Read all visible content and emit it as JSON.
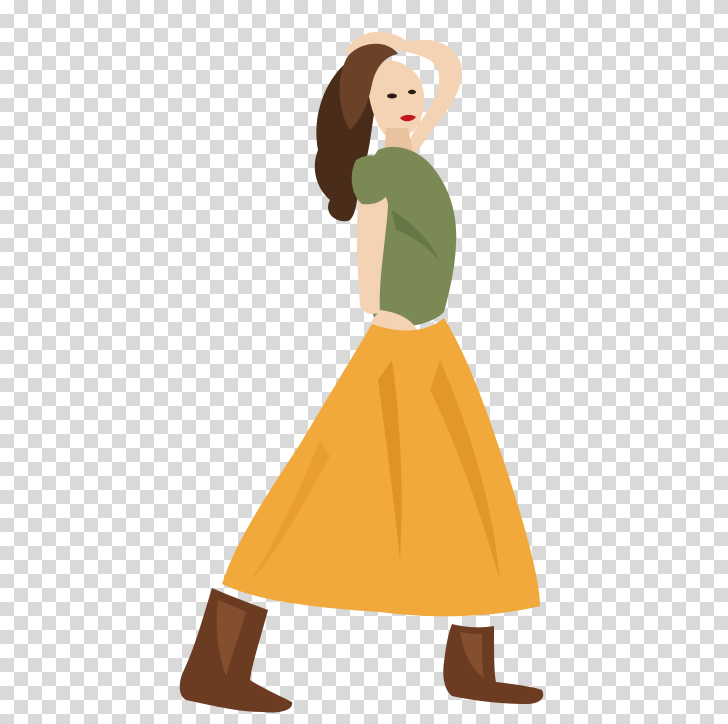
{
  "image": {
    "background": "transparency-checkerboard",
    "subject": "woman-illustration"
  },
  "colors": {
    "checker_light": "#ffffff",
    "checker_dark": "#d9d9d9",
    "skin": "#f3d3b4",
    "skin_shadow": "#d9a98a",
    "hair": "#4a2c1a",
    "hair_highlight": "#6b4127",
    "shirt": "#7b8a55",
    "shirt_shadow": "#5f6d3f",
    "skirt": "#f0a93a",
    "skirt_shadow": "#d98c1e",
    "boot": "#6b3b22",
    "boot_highlight": "#8b5532",
    "lips": "#c4161c"
  }
}
